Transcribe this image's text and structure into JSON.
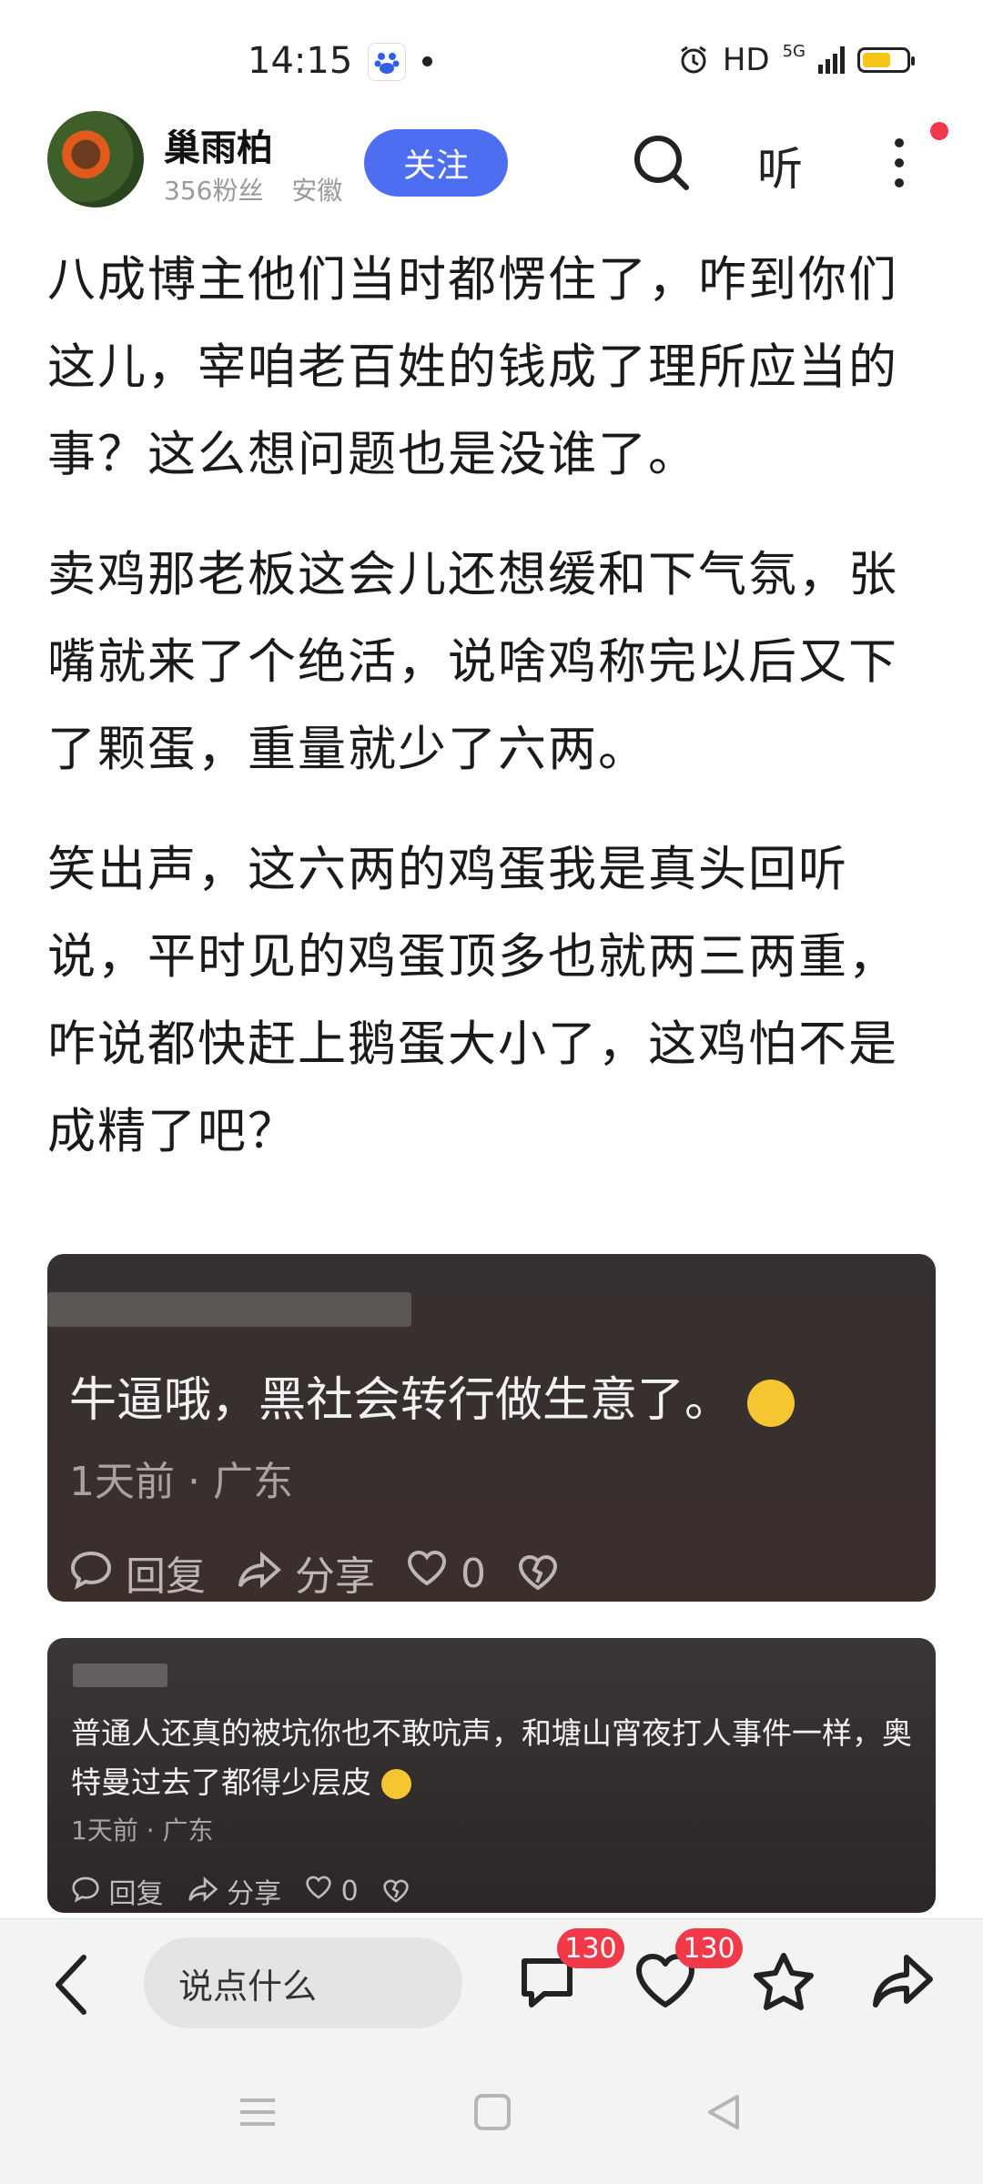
{
  "status_bar": {
    "time": "14:15",
    "network": "HD",
    "signal": "5G",
    "icons": [
      "baidu-app-icon",
      "notification-dot-icon",
      "alarm-icon",
      "signal-icon",
      "battery-icon"
    ]
  },
  "author": {
    "name": "巢雨柏",
    "fans": "356粉丝",
    "location": "安徽",
    "follow_label": "关注"
  },
  "header": {
    "listen_label": "听"
  },
  "article": {
    "paragraphs": [
      "八成博主他们当时都愣住了，咋到你们这儿，宰咱老百姓的钱成了理所应当的事？这么想问题也是没谁了。",
      "卖鸡那老板这会儿还想缓和下气氛，张嘴就来了个绝活，说啥鸡称完以后又下了颗蛋，重量就少了六两。",
      "笑出声，这六两的鸡蛋我是真头回听说，平时见的鸡蛋顶多也就两三两重，咋说都快赶上鹅蛋大小了，这鸡怕不是成精了吧？"
    ]
  },
  "comments": [
    {
      "text": "牛逼哦，黑社会转行做生意了。",
      "meta": "1天前 · 广东",
      "reply_label": "回复",
      "share_label": "分享",
      "likes": "0"
    },
    {
      "text": "普通人还真的被坑你也不敢吭声，和塘山宵夜打人事件一样，奥特曼过去了都得少层皮",
      "meta": "1天前 · 广东",
      "reply_label": "回复",
      "share_label": "分享",
      "likes": "0"
    }
  ],
  "bottom_bar": {
    "input_placeholder": "说点什么",
    "comment_count": "130",
    "like_count": "130"
  },
  "colors": {
    "accent": "#4e6ef2",
    "badge": "#f03a4a",
    "battery": "#f5c518"
  }
}
